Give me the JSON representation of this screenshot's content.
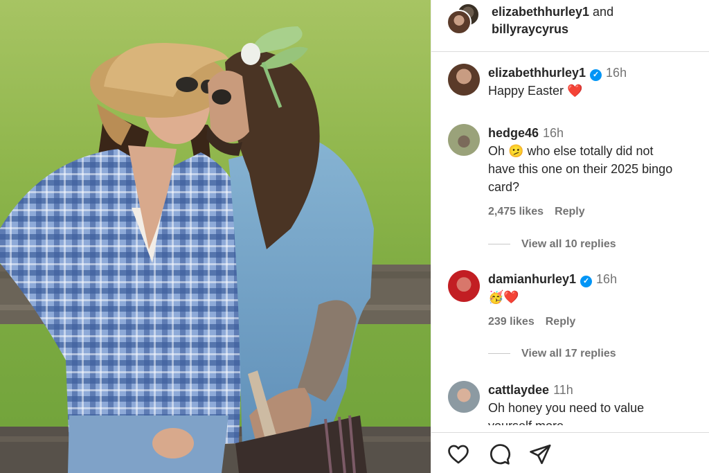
{
  "header": {
    "user1": "elizabethhurley1",
    "joiner": " and",
    "user2": "billyraycyrus"
  },
  "comments": [
    {
      "username": "elizabethhurley1",
      "verified": true,
      "time": "16h",
      "text": "Happy Easter",
      "emoji": "❤️"
    },
    {
      "username": "hedge46",
      "verified": false,
      "time": "16h",
      "text_lines": [
        "Oh 🫤 who else totally did not",
        "have this one on their 2025 bingo",
        "card?"
      ],
      "likes": "2,475 likes",
      "reply": "Reply",
      "view_replies": "View all 10 replies"
    },
    {
      "username": "damianhurley1",
      "verified": true,
      "time": "16h",
      "text": "🥳❤️",
      "likes": "239 likes",
      "reply": "Reply",
      "view_replies": "View all 17 replies"
    },
    {
      "username": "cattlaydee",
      "verified": false,
      "time": "11h",
      "text_lines": [
        "Oh honey you need to value",
        "yourself more"
      ]
    }
  ],
  "actions": {
    "like": "heart-icon",
    "comment": "comment-bubble-icon",
    "share": "paper-plane-icon"
  },
  "colors": {
    "verified": "#0095f6",
    "heart": "#ed1c24",
    "muted": "#737373"
  }
}
